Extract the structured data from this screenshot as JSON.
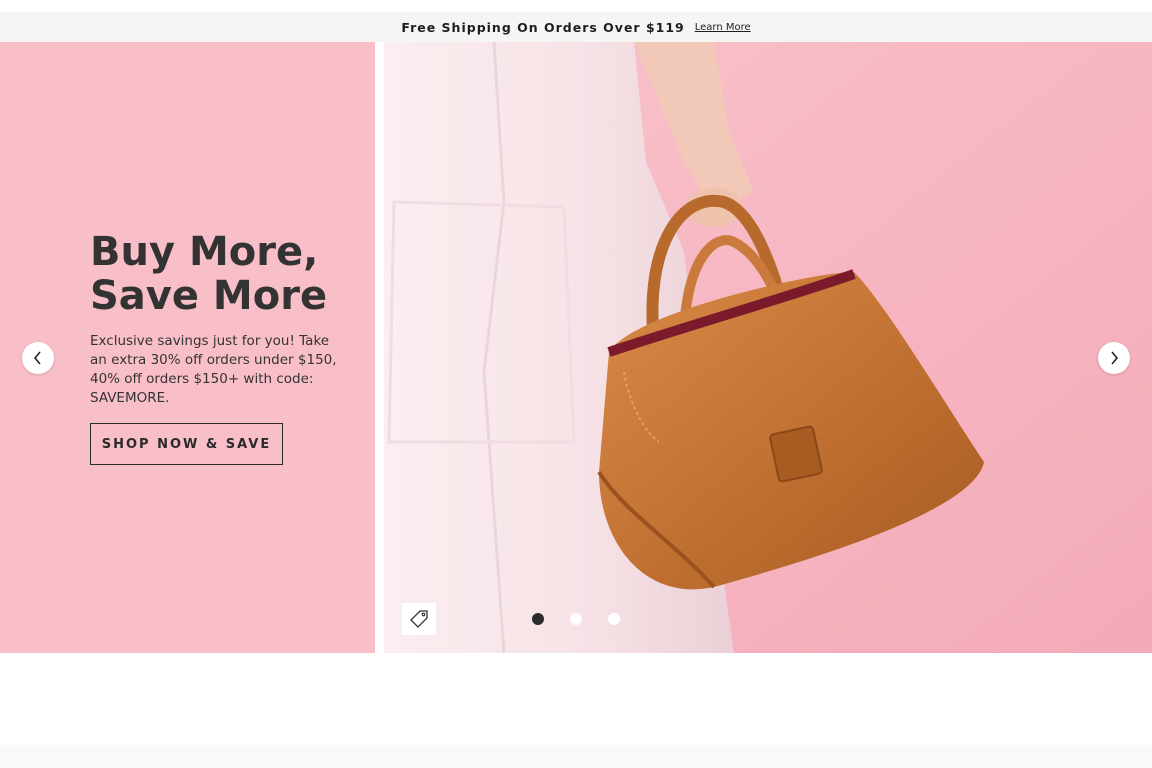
{
  "promo": {
    "text": "Free Shipping On Orders Over $119",
    "link": "Learn More"
  },
  "hero": {
    "headline_line1": "Buy More,",
    "headline_line2": "Save More",
    "subcopy": "Exclusive savings just for you! Take an extra 30% off orders under $150, 40% off orders $150+ with code: SAVEMORE.",
    "cta_label": "SHOP NOW & SAVE",
    "image_alt": "Model in white pants holding a brown leather handbag",
    "slide_count": 3,
    "active_slide": 1
  },
  "colors": {
    "hero_left_bg": "#f9bfc8",
    "hero_right_bg": "#f7b5c0",
    "text_dark": "#333333",
    "bag_leather": "#c97a3c"
  },
  "icons": {
    "prev": "chevron-left-icon",
    "next": "chevron-right-icon",
    "tag": "price-tag-icon"
  }
}
